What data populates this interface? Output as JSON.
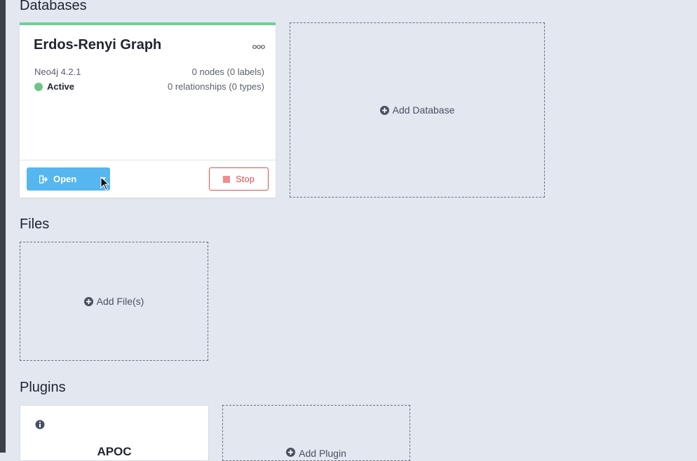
{
  "sections": {
    "databases": "Databases",
    "files": "Files",
    "plugins": "Plugins"
  },
  "database": {
    "name": "Erdos-Renyi Graph",
    "version": "Neo4j 4.2.1",
    "status": "Active",
    "nodes": "0 nodes (0 labels)",
    "relationships": "0 relationships (0 types)",
    "open_label": "Open",
    "stop_label": "Stop"
  },
  "actions": {
    "add_database": "Add Database",
    "add_files": "Add File(s)",
    "add_plugin": "Add Plugin"
  },
  "plugin": {
    "name": "APOC"
  },
  "colors": {
    "active": "#6cc489",
    "primary": "#56b6f0",
    "danger": "#d9534f",
    "card_accent": "#6fcf97"
  },
  "icons": {
    "more": "more-icon",
    "open": "open-icon",
    "stop": "stop-icon",
    "add": "plus-circle-icon",
    "info": "info-icon"
  }
}
